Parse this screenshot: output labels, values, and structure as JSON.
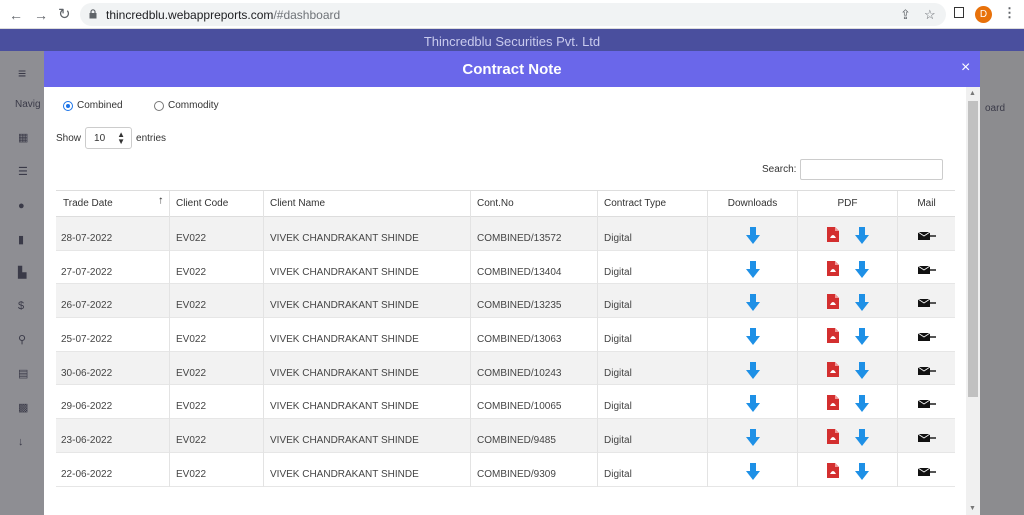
{
  "browser": {
    "url_host": "thincredblu.webappreports.com",
    "url_path": "/#dashboard",
    "avatar_letter": "D"
  },
  "app": {
    "title": "Thincredblu Securities Pvt. Ltd",
    "behind_left": "Navig",
    "behind_right": "oard"
  },
  "modal": {
    "title": "Contract Note",
    "close": "×",
    "radios": [
      {
        "label": "Combined",
        "checked": true
      },
      {
        "label": "Commodity",
        "checked": false
      }
    ],
    "show_label": "Show",
    "entries_value": "10",
    "entries_label": "entries",
    "search_label": "Search:"
  },
  "table": {
    "headers": [
      "Trade Date",
      "Client Code",
      "Client Name",
      "Cont.No",
      "Contract Type",
      "Downloads",
      "PDF",
      "Mail"
    ],
    "rows": [
      [
        "28-07-2022",
        "EV022",
        "VIVEK CHANDRAKANT SHINDE",
        "COMBINED/13572",
        "Digital"
      ],
      [
        "27-07-2022",
        "EV022",
        "VIVEK CHANDRAKANT SHINDE",
        "COMBINED/13404",
        "Digital"
      ],
      [
        "26-07-2022",
        "EV022",
        "VIVEK CHANDRAKANT SHINDE",
        "COMBINED/13235",
        "Digital"
      ],
      [
        "25-07-2022",
        "EV022",
        "VIVEK CHANDRAKANT SHINDE",
        "COMBINED/13063",
        "Digital"
      ],
      [
        "30-06-2022",
        "EV022",
        "VIVEK CHANDRAKANT SHINDE",
        "COMBINED/10243",
        "Digital"
      ],
      [
        "29-06-2022",
        "EV022",
        "VIVEK CHANDRAKANT SHINDE",
        "COMBINED/10065",
        "Digital"
      ],
      [
        "23-06-2022",
        "EV022",
        "VIVEK CHANDRAKANT SHINDE",
        "COMBINED/9485",
        "Digital"
      ],
      [
        "22-06-2022",
        "EV022",
        "VIVEK CHANDRAKANT SHINDE",
        "COMBINED/9309",
        "Digital"
      ]
    ]
  },
  "colors": {
    "modal_header": "#6a67ea",
    "download_blue": "#1e90e6",
    "pdf_red": "#d32f2f"
  }
}
